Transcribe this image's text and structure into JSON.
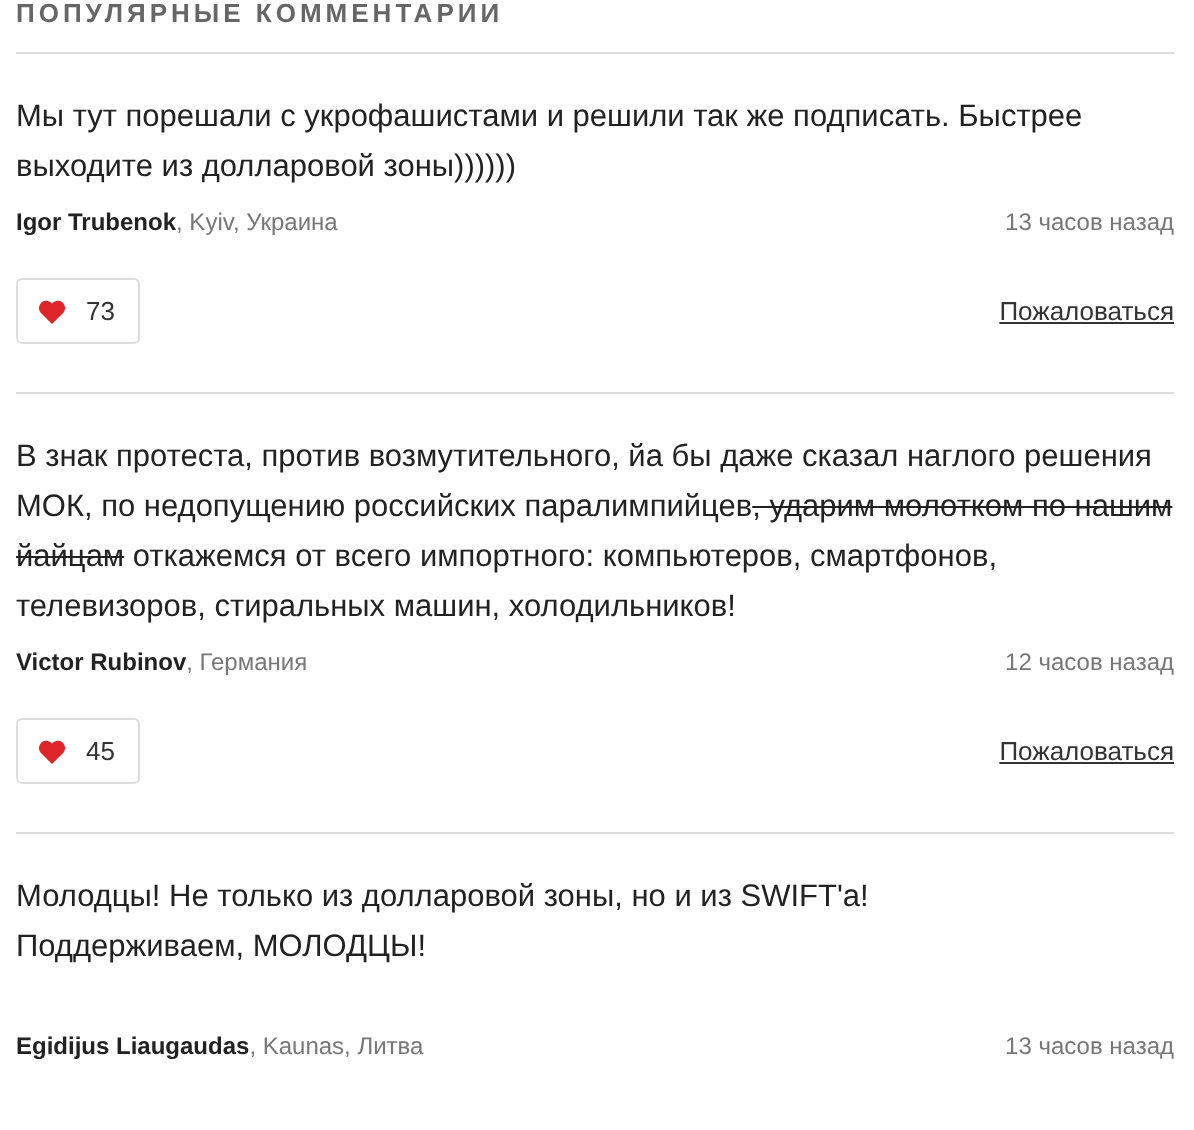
{
  "heading": "ПОПУЛЯРНЫЕ КОММЕНТАРИИ",
  "comments": [
    {
      "body": [
        {
          "text": "Мы тут порешали с укрофашистами и решили так же подписать. Быстрее выходите из долларовой зоны))))))",
          "struck": false
        }
      ],
      "author": "Igor Trubenok",
      "location": ", Kyiv, Украина",
      "time": "13 часов назад",
      "likes": "73",
      "report": "Пожаловаться"
    },
    {
      "body": [
        {
          "text": "В знак протеста, против возмутительного, йа бы даже сказал наглого решения МОК, по недопущению российских паралимпийцев",
          "struck": false
        },
        {
          "text": ", ударим молотком по нашим йайцам",
          "struck": true
        },
        {
          "text": " откажемся от всего импортного: компьютеров, смартфонов, телевизоров, стиральных машин, холодильников!",
          "struck": false
        }
      ],
      "author": "Victor Rubinov",
      "location": ", Германия",
      "time": "12 часов назад",
      "likes": "45",
      "report": "Пожаловаться"
    },
    {
      "body": [
        {
          "text": "Молодцы! Не только из долларовой зоны, но и из SWIFT'a!\nПоддерживаем, МОЛОДЦЫ!",
          "struck": false
        }
      ],
      "author": "Egidijus Liaugaudas",
      "location": ", Kaunas, Литва",
      "time": "13 часов назад"
    }
  ]
}
